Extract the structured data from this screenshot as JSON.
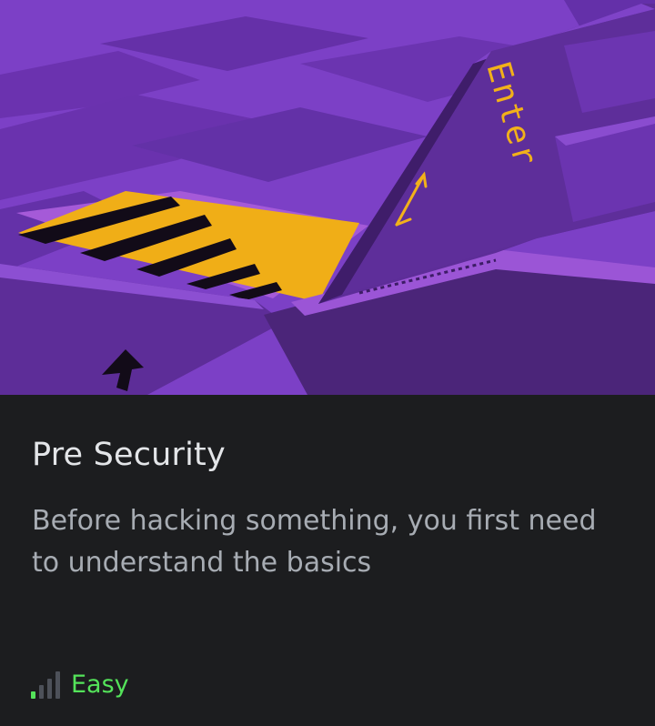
{
  "card": {
    "title": "Pre Security",
    "description": "Before hacking something, you first need to understand the basics",
    "difficulty": {
      "label": "Easy",
      "level": 1,
      "max_level": 4,
      "icon": "signal-bars-icon",
      "active_color": "#54e35a",
      "inactive_color": "#4d5159"
    },
    "hero_image": {
      "subject": "enter-key-icon",
      "key_text": "Enter",
      "palette": {
        "base": "#7b3fc4",
        "key": "#5b2b95",
        "accent": "#f2b11a"
      }
    }
  }
}
